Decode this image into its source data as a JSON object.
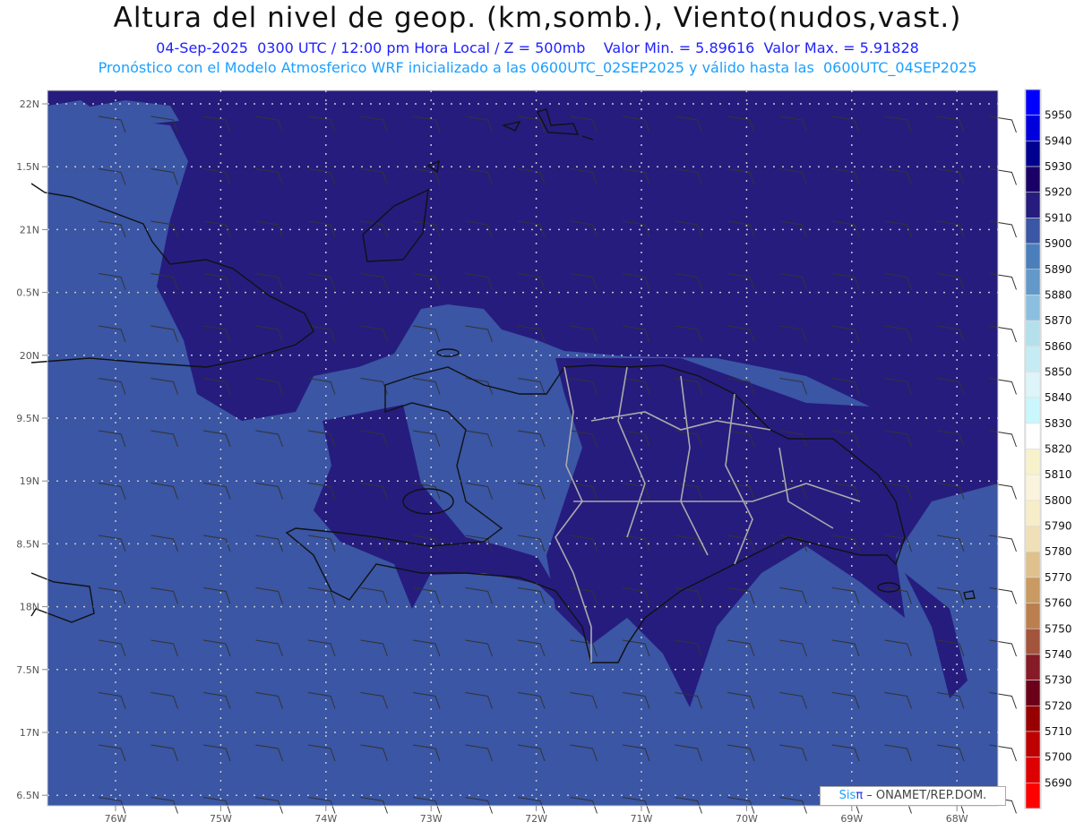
{
  "header": {
    "title": "Altura del nivel de geop. (km,somb.), Viento(nudos,vast.)",
    "subtitle": "04-Sep-2025  0300 UTC / 12:00 pm Hora Local / Z = 500mb    Valor Min. = 5.89616  Valor Max. = 5.91828",
    "model_line": "Pronóstico con el Modelo Atmosferico WRF inicializado a las 0600UTC_02SEP2025 y válido hasta las  0600UTC_04SEP2025"
  },
  "axes": {
    "lat_labels": [
      "22N",
      "1.5N",
      "21N",
      "0.5N",
      "20N",
      "9.5N",
      "19N",
      "8.5N",
      "18N",
      "7.5N",
      "17N",
      "6.5N"
    ],
    "lon_labels": [
      "76W",
      "75W",
      "74W",
      "73W",
      "72W",
      "71W",
      "70W",
      "69W",
      "68W"
    ]
  },
  "colorbar": {
    "labels": [
      "5950",
      "5940",
      "5930",
      "5920",
      "5910",
      "5900",
      "5890",
      "5880",
      "5870",
      "5860",
      "5850",
      "5840",
      "5830",
      "5820",
      "5810",
      "5800",
      "5790",
      "5780",
      "5770",
      "5760",
      "5750",
      "5740",
      "5730",
      "5720",
      "5710",
      "5700",
      "5690"
    ],
    "colors": [
      "#0000ff",
      "#0000dd",
      "#00008f",
      "#1a0066",
      "#261c7e",
      "#3a56a4",
      "#4a7fbb",
      "#6299c9",
      "#8cbfdf",
      "#b4e0ec",
      "#c4ecf2",
      "#ddf4f8",
      "#c9f7fb",
      "#ffffff",
      "#f8f2cc",
      "#faf4dd",
      "#f7edc8",
      "#f0e0b8",
      "#dfc18e",
      "#c99a62",
      "#bb7f4f",
      "#a3553c",
      "#861a27",
      "#6b0018",
      "#960000",
      "#bd0000",
      "#dd0000",
      "#ff0000"
    ]
  },
  "map_colors": {
    "base": "#3a56a4",
    "high": "#261c7e",
    "light": "#4a7fbb"
  },
  "credit": {
    "sis": "Sis",
    "pi": "π",
    "rest": "– ONAMET/REP.DOM."
  }
}
